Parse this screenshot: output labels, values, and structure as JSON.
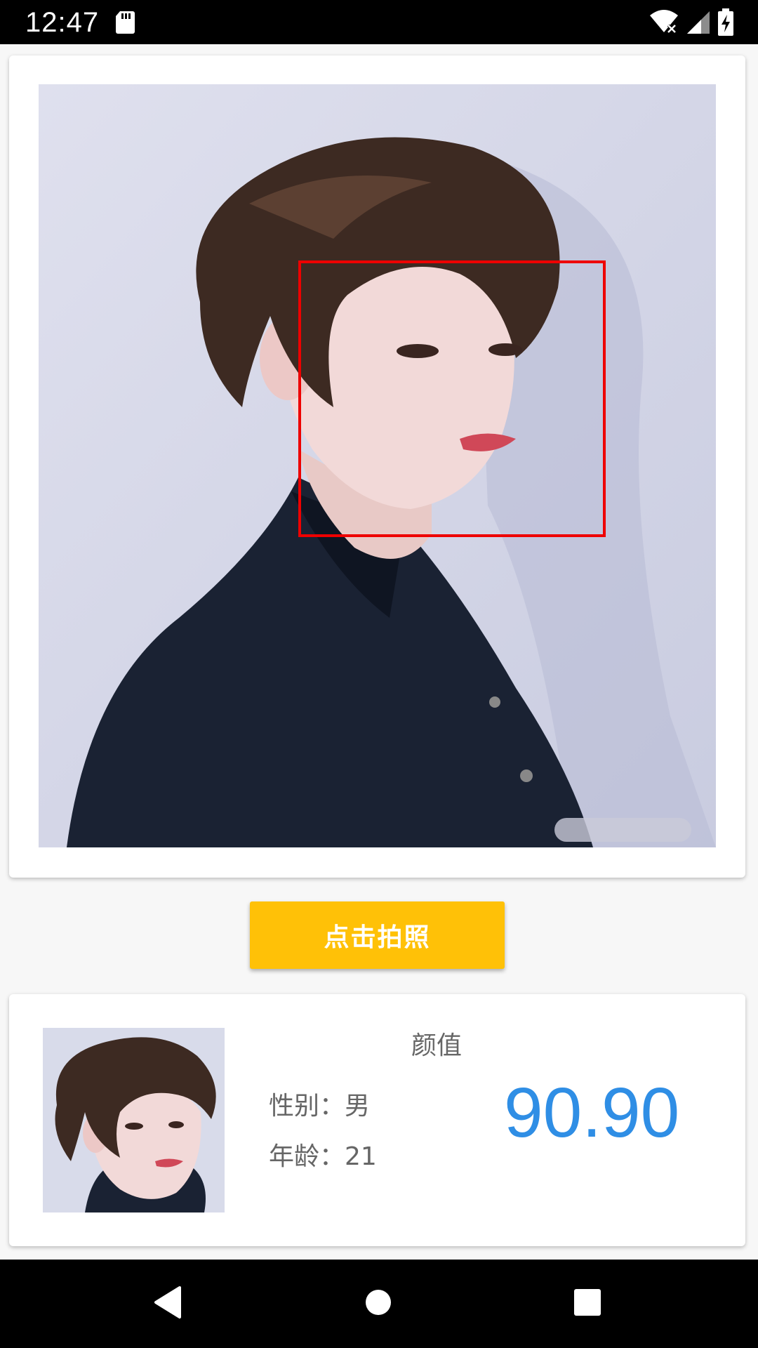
{
  "status_bar": {
    "time": "12:47",
    "icons": [
      "sd-card-icon",
      "wifi-icon",
      "signal-icon",
      "battery-charging-icon"
    ]
  },
  "photo_card": {
    "image": "portrait-photo",
    "face_box_color": "#ee0000"
  },
  "capture_button": {
    "label": "点击拍照",
    "color": "#ffc107"
  },
  "result": {
    "score_label": "颜值",
    "gender_label": "性别：",
    "gender_value": "男",
    "age_label": "年龄：",
    "age_value": "21",
    "score_value": "90.90",
    "score_color": "#2f8ee5"
  },
  "nav_bar": {
    "buttons": [
      "back-icon",
      "home-icon",
      "recents-icon"
    ]
  }
}
